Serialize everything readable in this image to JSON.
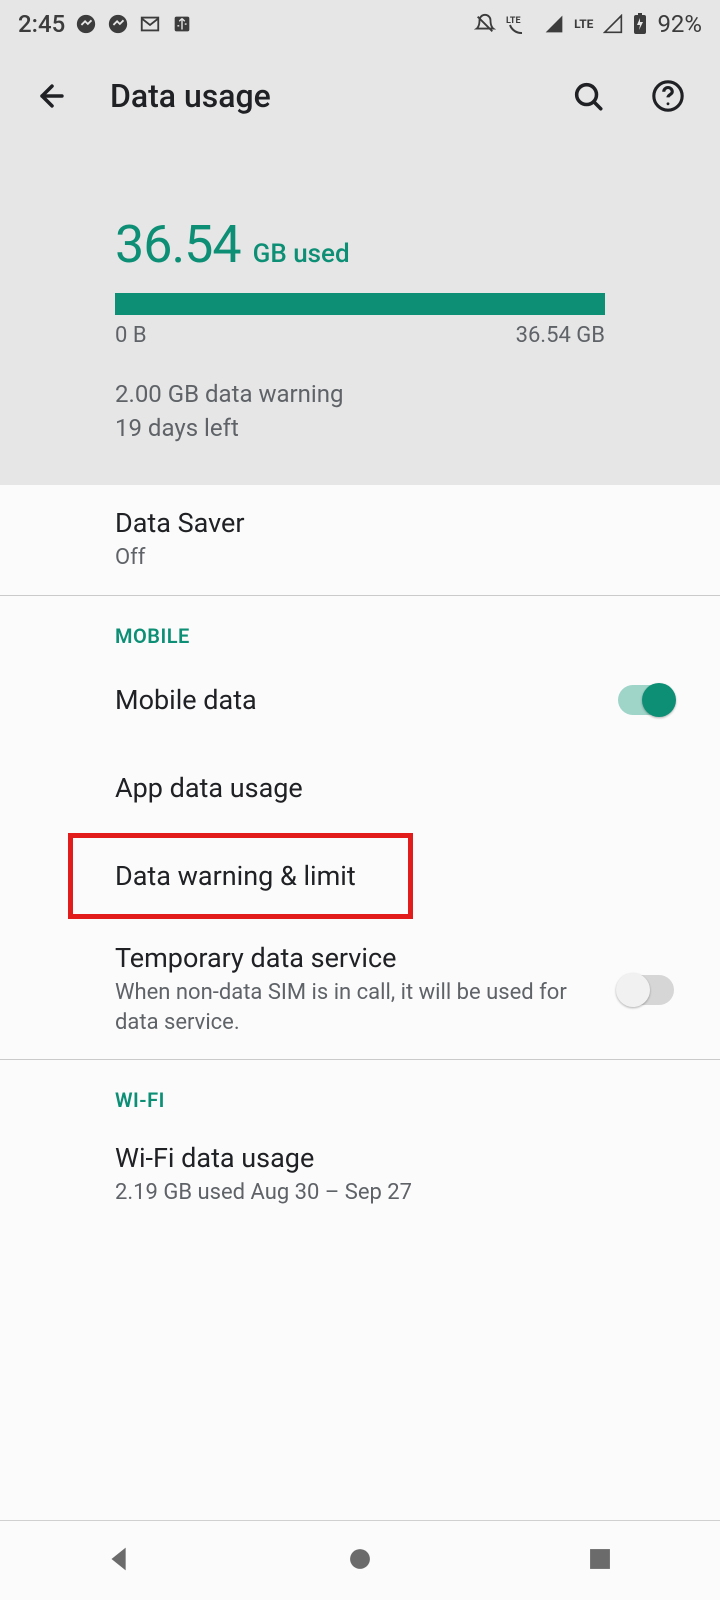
{
  "statusbar": {
    "time": "2:45",
    "battery_pct": "92%"
  },
  "header": {
    "title": "Data usage"
  },
  "usage": {
    "amount": "36.54",
    "unit": "GB used",
    "bar_min": "0 B",
    "bar_max": "36.54 GB",
    "warning_line": "2.00 GB data warning",
    "days_left": "19 days left",
    "fill_pct": 100
  },
  "rows": {
    "data_saver": {
      "title": "Data Saver",
      "sub": "Off"
    },
    "section_mobile": "MOBILE",
    "mobile_data": {
      "title": "Mobile data",
      "toggle_on": true
    },
    "app_data_usage": {
      "title": "App data usage"
    },
    "data_warning_limit": {
      "title": "Data warning & limit"
    },
    "temporary": {
      "title": "Temporary data service",
      "sub": "When non-data SIM is in call, it will be used for data service.",
      "toggle_on": false
    },
    "section_wifi": "WI-FI",
    "wifi_usage": {
      "title": "Wi-Fi data usage",
      "sub": "2.19 GB used Aug 30 – Sep 27"
    }
  },
  "colors": {
    "accent": "#0d8f76",
    "annotate": "#e21b1b"
  }
}
